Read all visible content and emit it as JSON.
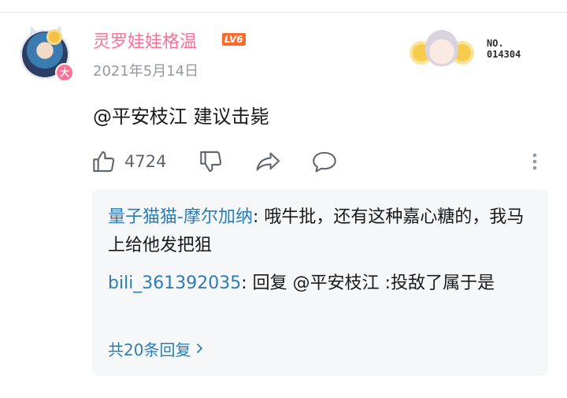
{
  "comment": {
    "author": {
      "name": "灵罗娃娃格温",
      "level_badge": "LV6",
      "vip_badge": "大",
      "fan_badge_number_prefix": "NO.",
      "fan_badge_number": "014304"
    },
    "date": "2021年5月14日",
    "text": "@平安枝江 建议击毙",
    "like_count": "4724"
  },
  "actions": {
    "icons": [
      "thumb-up-icon",
      "thumb-down-icon",
      "share-icon",
      "comment-icon",
      "more-vertical-icon"
    ]
  },
  "replies": {
    "items": [
      {
        "name": "量子猫猫-摩尔加纳",
        "text": ": 哦牛批，还有这种嘉心糖的，我马上给他发把狙"
      },
      {
        "name": "bili_361392035",
        "text": ": 回复 @平安枝江 :投敌了属于是"
      }
    ],
    "more_label": "共20条回复"
  },
  "colors": {
    "username": "#fb7299",
    "reply_name": "#2d7db4",
    "level_badge": "#ff6a2a",
    "reply_bg": "#f6f7f8"
  }
}
